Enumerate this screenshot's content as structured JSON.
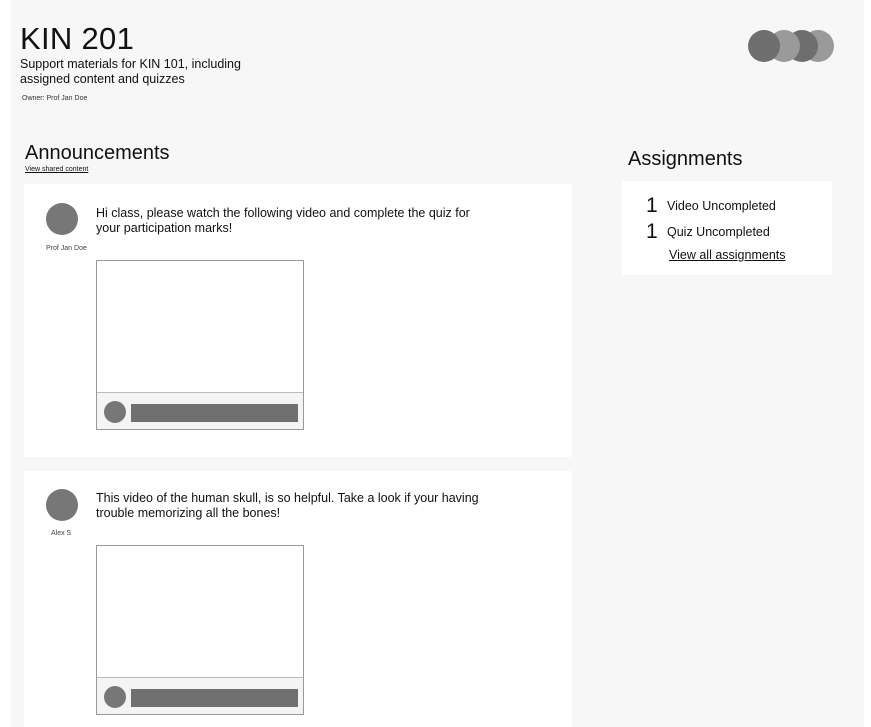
{
  "course": {
    "title": "KIN 201",
    "description": "Support materials for KIN 101, including assigned content and quizzes",
    "owner": "Owner: Prof Jan Doe"
  },
  "members": {
    "colors": [
      "#6e6e6e",
      "#9a9a9a",
      "#6e6e6e",
      "#9a9a9a"
    ]
  },
  "announcements": {
    "title": "Announcements",
    "link": "View shared content",
    "posts": [
      {
        "author": "Prof Jan Doe",
        "message": "Hi class, please watch the following video and complete the quiz for your participation marks!"
      },
      {
        "author": "Alex S",
        "message": "This video of the human skull, is so helpful. Take a look if your having trouble memorizing all the bones!"
      }
    ]
  },
  "assignments": {
    "title": "Assignments",
    "items": [
      {
        "count": "1",
        "label": "Video Uncompleted"
      },
      {
        "count": "1",
        "label": "Quiz Uncompleted"
      }
    ],
    "link": "View all assignments"
  }
}
